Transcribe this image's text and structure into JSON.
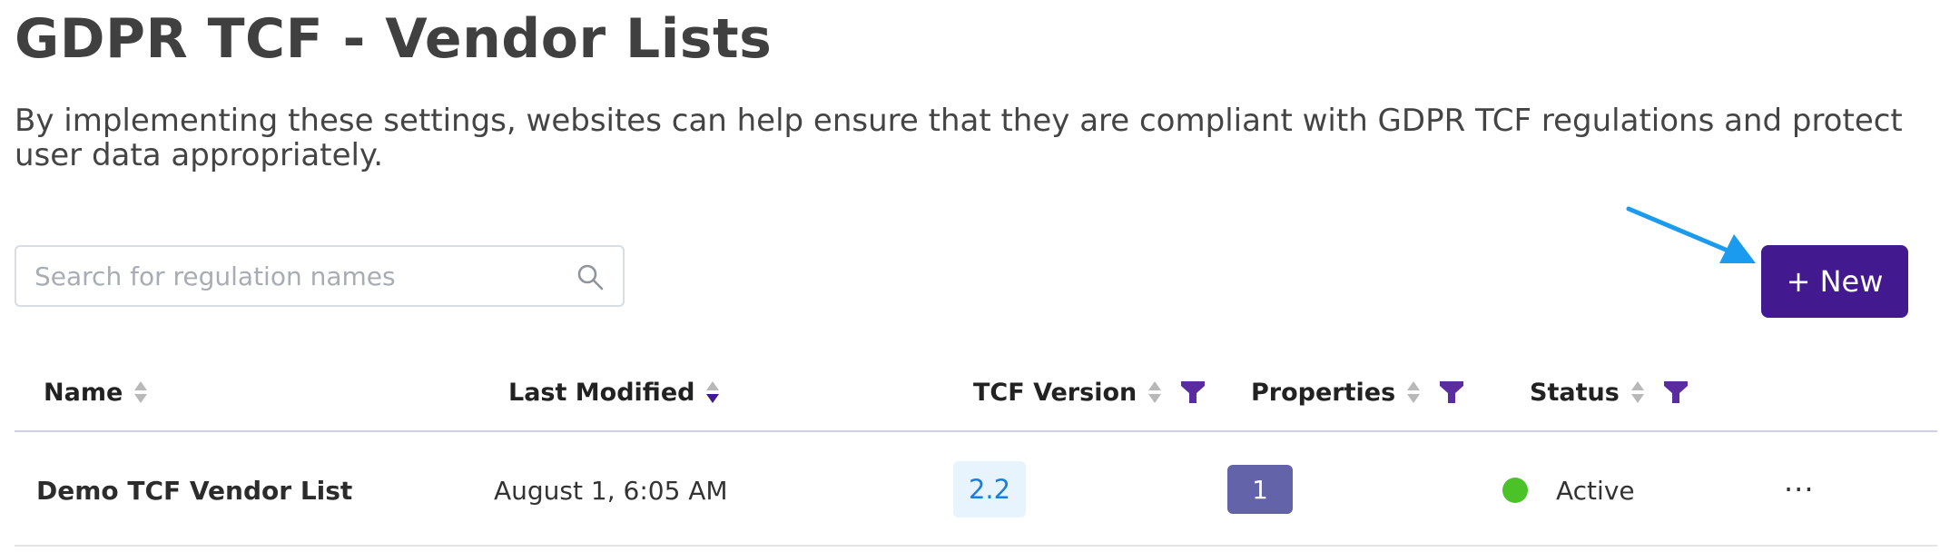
{
  "page": {
    "title": "GDPR TCF - Vendor Lists",
    "description": "By implementing these settings, websites can help ensure that they are compliant with GDPR TCF regulations and protect user data appropriately."
  },
  "search": {
    "placeholder": "Search for regulation names",
    "value": "",
    "icon": "search-icon"
  },
  "actions": {
    "new_label": "+ New"
  },
  "table": {
    "columns": [
      {
        "label": "Name",
        "sortable": true,
        "filterable": false
      },
      {
        "label": "Last Modified",
        "sortable": true,
        "sorted": "descending",
        "filterable": false
      },
      {
        "label": "TCF Version",
        "sortable": true,
        "filterable": true
      },
      {
        "label": "Properties",
        "sortable": true,
        "filterable": true
      },
      {
        "label": "Status",
        "sortable": true,
        "filterable": true
      }
    ],
    "rows": [
      {
        "name": "Demo TCF Vendor List",
        "last_modified": "August 1, 6:05 AM",
        "tcf_version": "2.2",
        "properties": "1",
        "status": "Active",
        "more": "···"
      }
    ]
  },
  "colors": {
    "primary": "#43198f",
    "filter_icon": "#5a2ca0",
    "annotation_arrow": "#1a9bf0",
    "status_active": "#4ac228",
    "version_badge_bg": "#e7f3fd",
    "version_badge_text": "#1b7fd8",
    "properties_badge_bg": "#6363aa"
  }
}
